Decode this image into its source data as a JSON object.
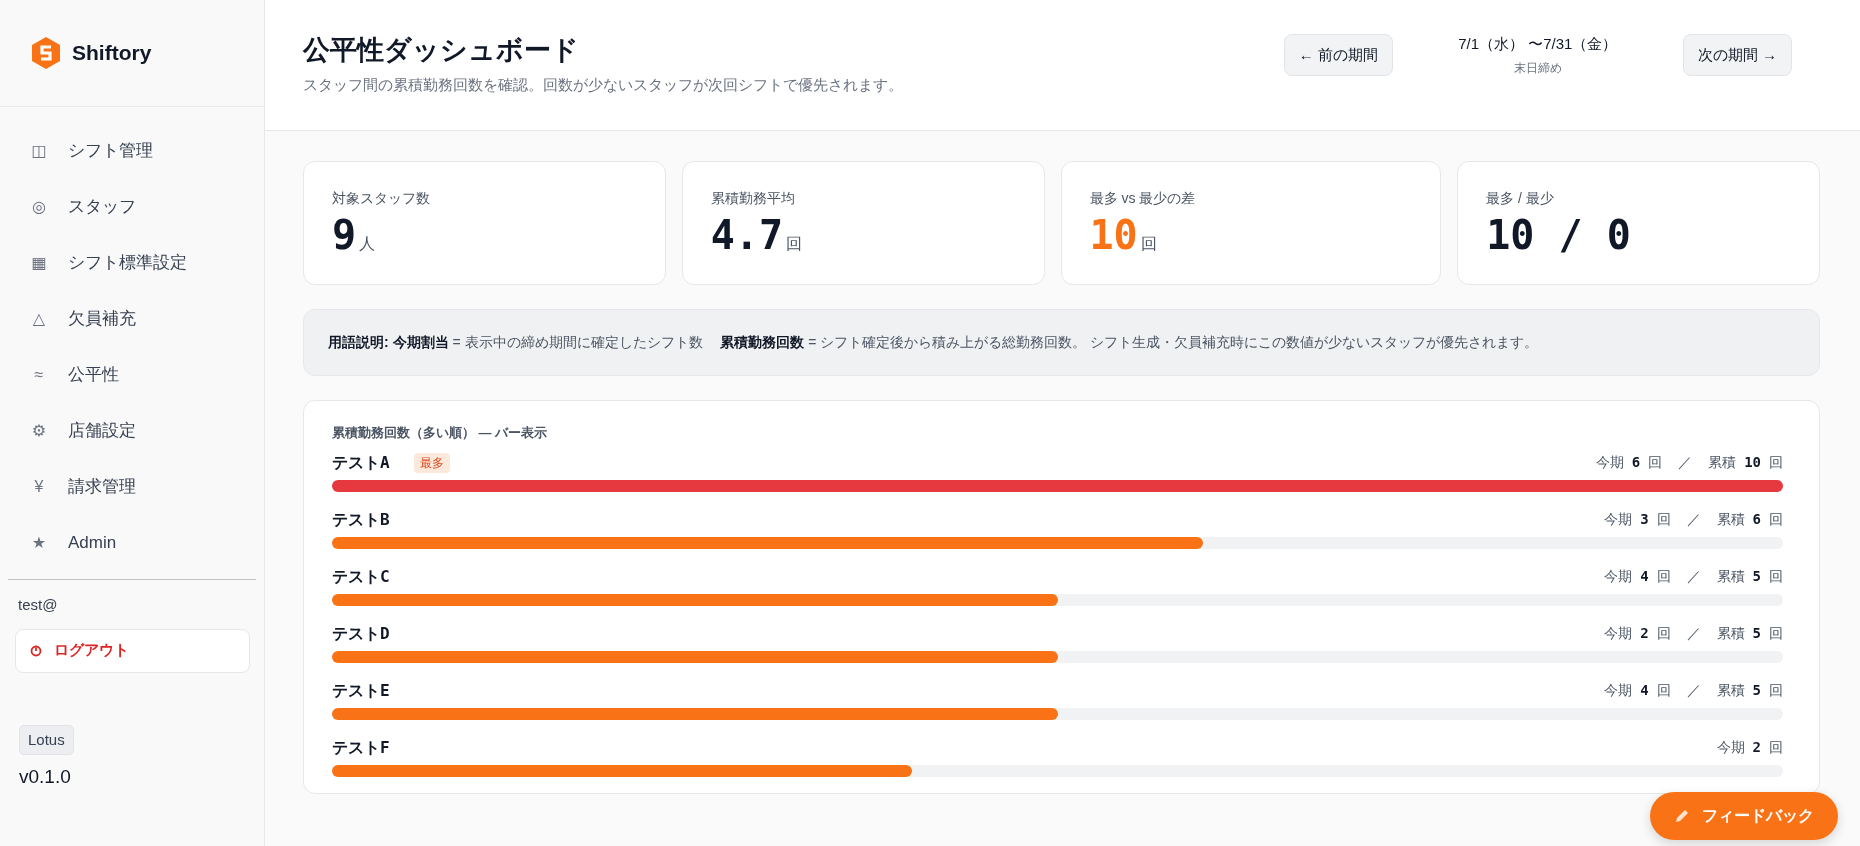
{
  "sidebar": {
    "brand": "Shiftory",
    "items": [
      {
        "icon": "◫",
        "label": "シフト管理"
      },
      {
        "icon": "◎",
        "label": "スタッフ"
      },
      {
        "icon": "▦",
        "label": "シフト標準設定"
      },
      {
        "icon": "△",
        "label": "欠員補充"
      },
      {
        "icon": "≈",
        "label": "公平性"
      },
      {
        "icon": "⚙",
        "label": "店舗設定"
      },
      {
        "icon": "¥",
        "label": "請求管理"
      },
      {
        "icon": "★",
        "label": "Admin"
      }
    ],
    "user": "test@",
    "logout": "ログアウト",
    "plan": "Lotus",
    "version": "v0.1.0"
  },
  "header": {
    "title": "公平性ダッシュボード",
    "subtitle": "スタッフ間の累積勤務回数を確認。回数が少ないスタッフが次回シフトで優先されます。",
    "prev": "← 前の期間",
    "range": "7/1（水） 〜7/31（金）",
    "closing": "末日締め",
    "next": "次の期間 →"
  },
  "stats": [
    {
      "label": "対象スタッフ数",
      "value": "9",
      "unit": "人",
      "highlight": false
    },
    {
      "label": "累積勤務平均",
      "value": "4.7",
      "unit": "回",
      "highlight": false
    },
    {
      "label": "最多 vs 最少の差",
      "value": "10",
      "unit": "回",
      "highlight": true
    },
    {
      "label": "最多 / 最少",
      "value": "10 / 0",
      "highlight": false
    }
  ],
  "legend": "**用語説明: 今期割当** = 表示中の締め期間に確定したシフト数　 **累積勤務回数** = シフト確定後から積み上がる総勤務回数。 シフト生成・欠員補充時にこの数値が少ないスタッフが優先されます。",
  "chart": {
    "title": "累積勤務回数（多い順） — バー表示",
    "rows": [
      {
        "name": "テストA",
        "badge": "最多",
        "period_label": "今期",
        "period": "6",
        "period_unit": "回",
        "sep": "／",
        "total_label": "累積",
        "total": "10",
        "total_unit": "回",
        "level": 1.0,
        "color": "#e5393f"
      },
      {
        "name": "テストB",
        "period_label": "今期",
        "period": "3",
        "period_unit": "回",
        "sep": "／",
        "total_label": "累積",
        "total": "6",
        "total_unit": "回",
        "level": 0.6,
        "color": "#f97316"
      },
      {
        "name": "テストC",
        "period_label": "今期",
        "period": "4",
        "period_unit": "回",
        "sep": "／",
        "total_label": "累積",
        "total": "5",
        "total_unit": "回",
        "level": 0.5,
        "color": "#f97316"
      },
      {
        "name": "テストD",
        "period_label": "今期",
        "period": "2",
        "period_unit": "回",
        "sep": "／",
        "total_label": "累積",
        "total": "5",
        "total_unit": "回",
        "level": 0.5,
        "color": "#f97316"
      },
      {
        "name": "テストE",
        "period_label": "今期",
        "period": "4",
        "period_unit": "回",
        "sep": "／",
        "total_label": "累積",
        "total": "5",
        "total_unit": "回",
        "level": 0.5,
        "color": "#f97316"
      },
      {
        "name": "テストF",
        "period_label": "今期",
        "period": "2",
        "period_unit": "回",
        "level": 0.4,
        "color": "#f97316"
      }
    ]
  },
  "feedback": "フィードバック"
}
